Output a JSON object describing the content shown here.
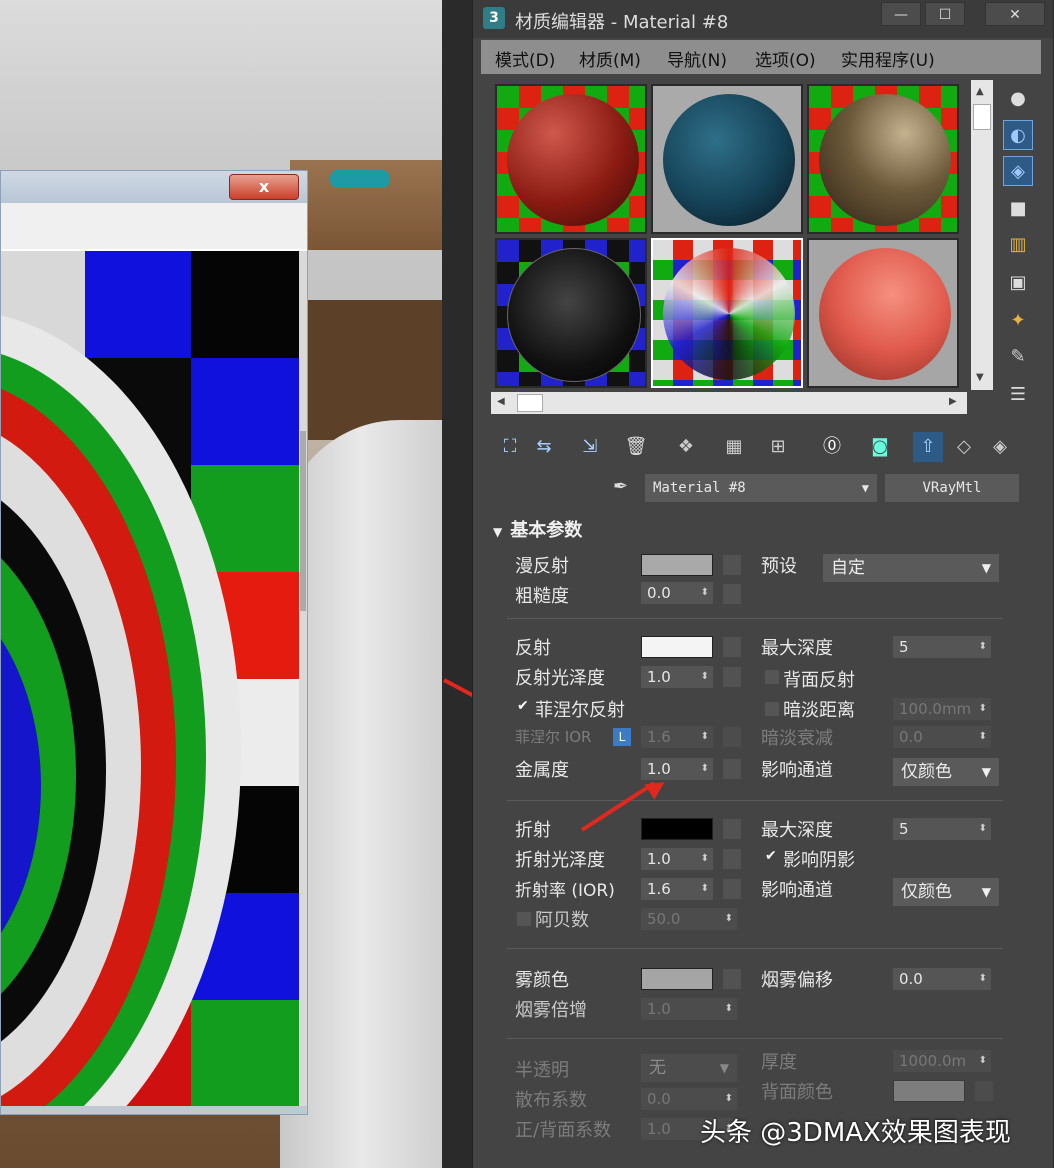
{
  "preview": {
    "close_glyph": "x"
  },
  "editor": {
    "app_icon": "3",
    "title": "材质编辑器 - Material #8",
    "win_minimize": "—",
    "win_maximize": "☐",
    "win_close": "✕",
    "menu": [
      "模式(D)",
      "材质(M)",
      "导航(N)",
      "选项(O)",
      "实用程序(U)"
    ],
    "material_name": "Material #8",
    "material_type": "VRayMtl",
    "rollout_title": "基本参数",
    "diffuse_label": "漫反射",
    "roughness_label": "粗糙度",
    "roughness_value": "0.0",
    "preset_label": "预设",
    "preset_value": "自定",
    "reflect_label": "反射",
    "reflect_gloss_label": "反射光泽度",
    "reflect_gloss_value": "1.0",
    "fresnel_label": "菲涅尔反射",
    "fresnel_ior_label": "菲涅尔 IOR",
    "fresnel_ior_lock": "L",
    "fresnel_ior_value": "1.6",
    "metal_label": "金属度",
    "metal_value": "1.0",
    "max_depth_label": "最大深度",
    "max_depth_value": "5",
    "backface_label": "背面反射",
    "dim_dist_label": "暗淡距离",
    "dim_dist_value": "100.0mm",
    "dim_falloff_label": "暗淡衰减",
    "dim_falloff_value": "0.0",
    "affect_channels_label": "影响通道",
    "affect_channels_value": "仅颜色",
    "refract_label": "折射",
    "refract_gloss_label": "折射光泽度",
    "refract_gloss_value": "1.0",
    "ior_label": "折射率 (IOR)",
    "ior_value": "1.6",
    "abbe_label": "阿贝数",
    "abbe_value": "50.0",
    "refr_max_depth_label": "最大深度",
    "refr_max_depth_value": "5",
    "affect_shadows_label": "影响阴影",
    "refr_affect_channels_label": "影响通道",
    "refr_affect_channels_value": "仅颜色",
    "fog_color_label": "雾颜色",
    "fog_bias_label": "烟雾偏移",
    "fog_bias_value": "0.0",
    "fog_mult_label": "烟雾倍增",
    "fog_mult_value": "1.0",
    "translucency_label": "半透明",
    "translucency_value": "无",
    "thickness_label": "厚度",
    "thickness_value": "1000.0m",
    "scatter_label": "散布系数",
    "scatter_value": "0.0",
    "backside_color_label": "背面颜色",
    "fwd_bck_label": "正/背面系数",
    "fwd_bck_value": "1.0"
  },
  "colors": {
    "diffuse": "#a9a9a9",
    "reflect": "#f4f4f4",
    "refract": "#000000",
    "fog": "#a5a5a5",
    "backside": "#7d7d7d",
    "annotation": "#e0281f"
  },
  "watermark": "头条 @3DMAX效果图表现"
}
